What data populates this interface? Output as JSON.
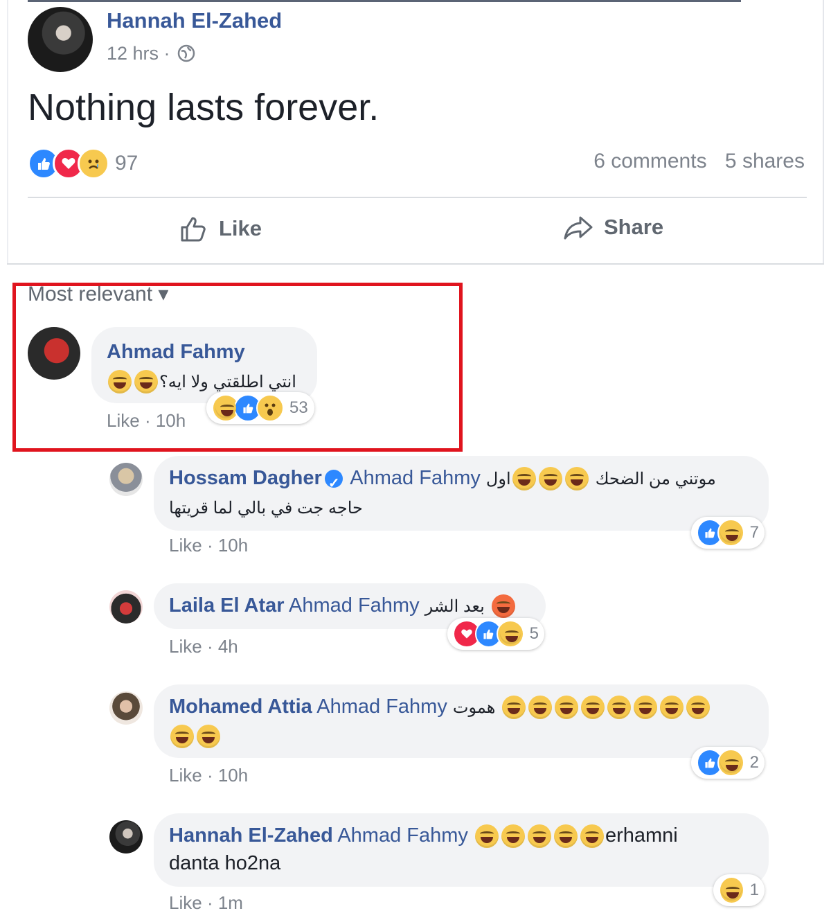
{
  "post": {
    "author": "Hannah El-Zahed",
    "time": "12 hrs · ",
    "text": "Nothing lasts forever.",
    "reaction_count": "97",
    "comments": "6 comments",
    "shares": "5 shares",
    "like_label": "Like",
    "share_label": "Share"
  },
  "comments_section": {
    "sort_label": "Most relevant ▾"
  },
  "comments": [
    {
      "name": "Ahmad Fahmy",
      "text": "انتي اطلقتي ولا ايه؟",
      "like": "Like",
      "time": "· 10h",
      "reaction_count": "53"
    },
    {
      "name": "Hossam Dagher",
      "mention": "Ahmad Fahmy",
      "text_line1": "موتني من الضحك",
      "text_mid": "اول",
      "text_line2": "حاجه جت في بالي لما قريتها",
      "like": "Like",
      "time": "· 10h",
      "reaction_count": "7"
    },
    {
      "name": "Laila El Atar",
      "mention": "Ahmad Fahmy",
      "text": "بعد الشر",
      "like": "Like",
      "time": "· 4h",
      "reaction_count": "5"
    },
    {
      "name": "Mohamed Attia",
      "mention": "Ahmad Fahmy",
      "text": "هموت",
      "like": "Like",
      "time": "· 10h",
      "reaction_count": "2"
    },
    {
      "name": "Hannah El-Zahed",
      "mention": "Ahmad Fahmy",
      "text_after": "erhamni",
      "text_line2": "danta ho2na",
      "like": "Like",
      "time": "· 1m",
      "reaction_count": "1"
    }
  ],
  "colors": {
    "name_blue": "#385898",
    "highlight_red": "#e0141e",
    "like_blue": "#2d88ff",
    "love_red": "#f0284a",
    "emoji_yellow": "#f7c94f"
  }
}
